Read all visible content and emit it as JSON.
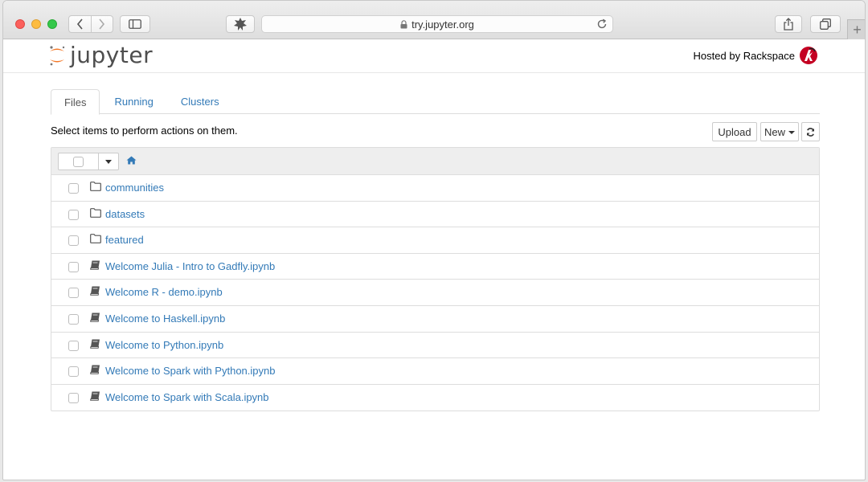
{
  "browser": {
    "url": "try.jupyter.org",
    "icons": [
      "chevron-left-icon",
      "chevron-right-icon",
      "sidebar-icon",
      "extension-icon",
      "lock-icon",
      "reload-icon",
      "share-icon",
      "tabs-icon",
      "plus-icon"
    ],
    "new_tab_label": "+"
  },
  "header": {
    "logo_text": "jupyter",
    "hosted_label": "Hosted by Rackspace"
  },
  "tabs": [
    {
      "label": "Files",
      "active": true
    },
    {
      "label": "Running",
      "active": false
    },
    {
      "label": "Clusters",
      "active": false
    }
  ],
  "toolbar": {
    "instructions": "Select items to perform actions on them.",
    "upload_label": "Upload",
    "new_label": "New"
  },
  "files": [
    {
      "name": "communities",
      "type": "folder"
    },
    {
      "name": "datasets",
      "type": "folder"
    },
    {
      "name": "featured",
      "type": "folder"
    },
    {
      "name": "Welcome Julia - Intro to Gadfly.ipynb",
      "type": "notebook"
    },
    {
      "name": "Welcome R - demo.ipynb",
      "type": "notebook"
    },
    {
      "name": "Welcome to Haskell.ipynb",
      "type": "notebook"
    },
    {
      "name": "Welcome to Python.ipynb",
      "type": "notebook"
    },
    {
      "name": "Welcome to Spark with Python.ipynb",
      "type": "notebook"
    },
    {
      "name": "Welcome to Spark with Scala.ipynb",
      "type": "notebook"
    }
  ],
  "colors": {
    "link": "#337ab7",
    "jupyter_orange": "#f37726",
    "rackspace_red": "#c40022"
  }
}
